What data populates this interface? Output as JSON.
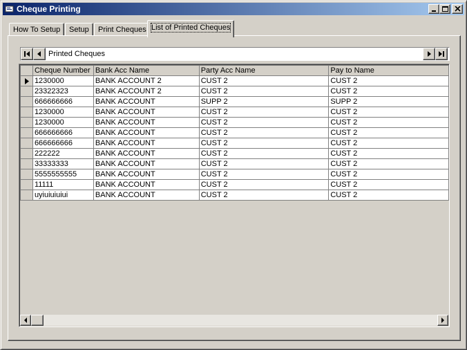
{
  "window": {
    "title": "Cheque Printing",
    "colors": {
      "title_bar_start": "#0a246a",
      "title_bar_end": "#a6caf0",
      "face": "#d4d0c8"
    }
  },
  "title_buttons": [
    "minimize-icon",
    "maximize-icon",
    "close-icon"
  ],
  "tabs": [
    {
      "label": "How To Setup"
    },
    {
      "label": "Setup"
    },
    {
      "label": "Print Cheques"
    },
    {
      "label": "List of Printed Cheques",
      "active": true
    }
  ],
  "data_control": {
    "caption": "Printed Cheques",
    "icons": [
      "first-record-icon",
      "previous-record-icon",
      "next-record-icon",
      "last-record-icon"
    ]
  },
  "grid": {
    "columns": [
      "Cheque Number",
      "Bank Acc Name",
      "Party Acc Name",
      "Pay to Name"
    ],
    "rows": [
      [
        "1230000",
        "BANK ACCOUNT 2",
        "CUST 2",
        "CUST 2"
      ],
      [
        "23322323",
        "BANK ACCOUNT 2",
        "CUST 2",
        "CUST 2"
      ],
      [
        "666666666",
        "BANK ACCOUNT",
        "SUPP 2",
        "SUPP 2"
      ],
      [
        "1230000",
        "BANK ACCOUNT",
        "CUST 2",
        "CUST 2"
      ],
      [
        "1230000",
        "BANK ACCOUNT",
        "CUST 2",
        "CUST 2"
      ],
      [
        "666666666",
        "BANK ACCOUNT",
        "CUST 2",
        "CUST 2"
      ],
      [
        "666666666",
        "BANK ACCOUNT",
        "CUST 2",
        "CUST 2"
      ],
      [
        "222222",
        "BANK ACCOUNT",
        "CUST 2",
        "CUST 2"
      ],
      [
        "33333333",
        "BANK ACCOUNT",
        "CUST 2",
        "CUST 2"
      ],
      [
        "5555555555",
        "BANK ACCOUNT",
        "CUST 2",
        "CUST 2"
      ],
      [
        "11111",
        "BANK ACCOUNT",
        "CUST 2",
        "CUST 2"
      ],
      [
        "uyiuiuiuiui",
        "BANK ACCOUNT",
        "CUST 2",
        "CUST 2"
      ]
    ],
    "current_row": 1
  }
}
